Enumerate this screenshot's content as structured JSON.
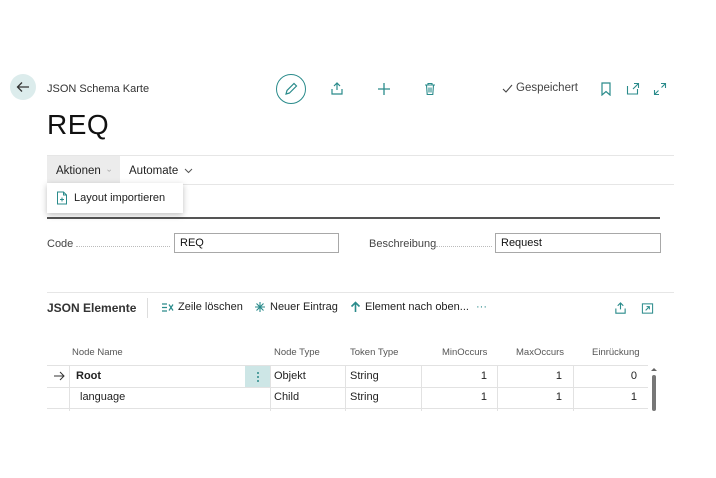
{
  "header": {
    "breadcrumb": "JSON Schema Karte",
    "title": "REQ",
    "saved_label": "Gespeichert"
  },
  "actionbar": {
    "tabs": [
      {
        "label": "Aktionen"
      },
      {
        "label": "Automate"
      }
    ],
    "dropdown_item": "Layout importieren"
  },
  "general": {
    "code_label": "Code",
    "code_value": "REQ",
    "description_label": "Beschreibung",
    "description_value": "Request"
  },
  "elements": {
    "title": "JSON Elemente",
    "actions": {
      "delete_row": "Zeile löschen",
      "new_entry": "Neuer Eintrag",
      "move_up": "Element nach oben...",
      "more": "···"
    },
    "columns": {
      "node_name": "Node Name",
      "node_type": "Node Type",
      "token_type": "Token Type",
      "min_occurs": "MinOccurs",
      "max_occurs": "MaxOccurs",
      "indent": "Einrückung"
    },
    "rows": [
      {
        "node_name": "Root",
        "node_type": "Objekt",
        "token_type": "String",
        "min_occurs": "1",
        "max_occurs": "1",
        "indent": "0"
      },
      {
        "node_name": "language",
        "node_type": "Child",
        "token_type": "String",
        "min_occurs": "1",
        "max_occurs": "1",
        "indent": "1"
      }
    ]
  },
  "colors": {
    "accent": "#2a8b8b",
    "selected_cell": "#cde6e6",
    "back_button_bg": "#dcecec"
  }
}
